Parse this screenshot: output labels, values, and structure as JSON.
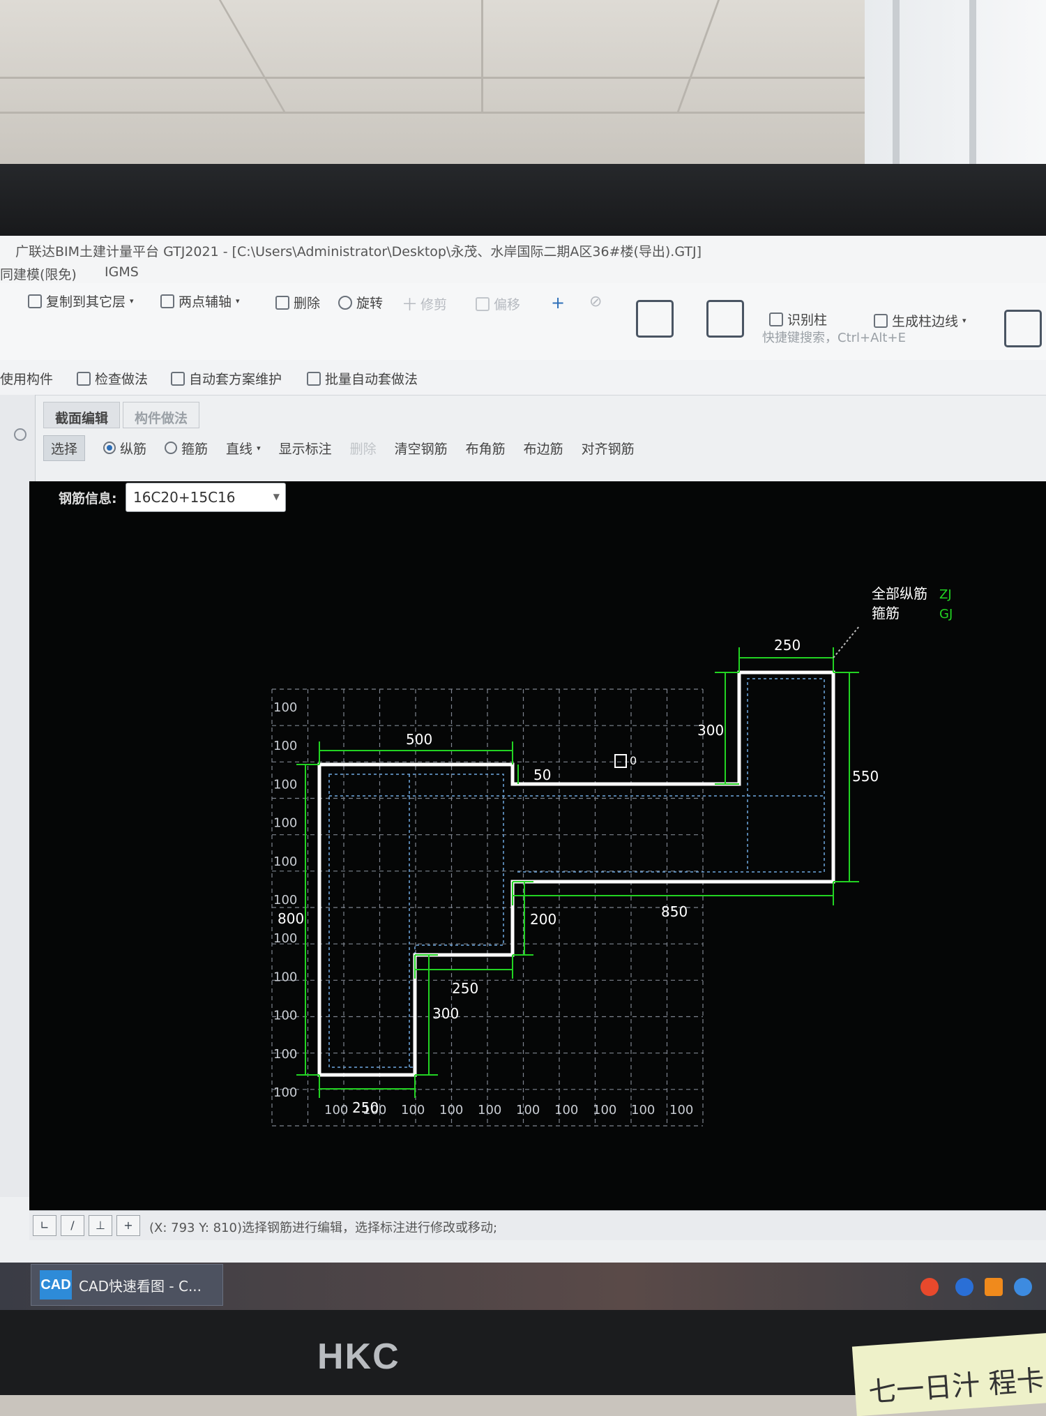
{
  "app": {
    "window_title": "广联达BIM土建计量平台 GTJ2021 - [C:\\Users\\Administrator\\Desktop\\永茂、水岸国际二期A区36#楼(导出).GTJ]",
    "menu": [
      "同建模(限免)",
      "IGMS"
    ],
    "shortcut_search": "快捷键搜索，Ctrl+Alt+E"
  },
  "ribbon": {
    "copy_to_layer": "复制到其它层",
    "two_point_axis": "两点辅轴",
    "delete": "删除",
    "rotate": "旋转",
    "trim": "修剪",
    "offset": "偏移",
    "identify_column": "识别柱",
    "gen_column_edge": "生成柱边线"
  },
  "toolbar2": {
    "use_component": "使用构件",
    "check_method": "检查做法",
    "auto_scheme": "自动套方案维护",
    "batch_auto": "批量自动套做法"
  },
  "tabs": [
    "截面编辑",
    "构件做法"
  ],
  "edit_toolbar": {
    "select": "选择",
    "longitudinal": "纵筋",
    "stirrup": "箍筋",
    "line": "直线",
    "show_dims": "显示标注",
    "delete": "删除",
    "clear_rebar": "清空钢筋",
    "corner_rebar": "布角筋",
    "edge_rebar": "布边筋",
    "align_rebar": "对齐钢筋"
  },
  "rebar_info": {
    "label": "钢筋信息:",
    "value": "16C20+15C16"
  },
  "drawing": {
    "legend": [
      {
        "label": "全部纵筋",
        "code": "ZJ"
      },
      {
        "label": "箍筋",
        "code": "GJ"
      }
    ],
    "grid_labels_left": [
      "100",
      "100",
      "100",
      "100",
      "100",
      "100",
      "100",
      "100",
      "100",
      "100",
      "100"
    ],
    "grid_labels_bottom": [
      "100",
      "100",
      "100",
      "100",
      "100",
      "100",
      "100",
      "100",
      "100",
      "100"
    ],
    "dims": {
      "top_left": "500",
      "top_right": "250",
      "step_small": "50",
      "riser_300_top": "300",
      "right_height": "550",
      "left_height": "800",
      "bottom_right": "850",
      "mid_step": "200",
      "lower_step": "250",
      "lower_riser": "300",
      "bottom_width": "250"
    },
    "marker": "0"
  },
  "status": {
    "coords_text": "(X: 793 Y: 810)选择钢筋进行编辑，选择标注进行修改或移动;"
  },
  "taskbar": {
    "app_icon": "CAD",
    "app_label": "CAD快速看图 - C..."
  },
  "photo": {
    "monitor_brand": "HKC",
    "note_text": "七一日汁 程卡"
  },
  "colors": {
    "dimension": "#22d322",
    "outline": "#ffffff",
    "grid": "#8a8f99",
    "canvas": "#050606"
  }
}
